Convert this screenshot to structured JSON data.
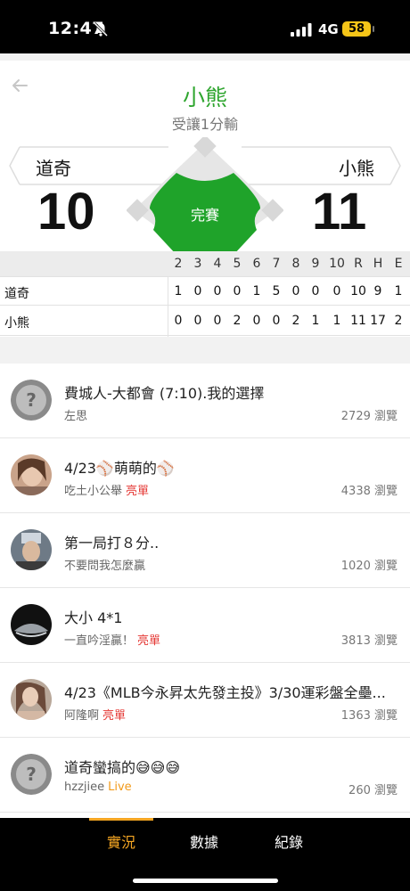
{
  "status_bar": {
    "time": "12:47",
    "network": "4G",
    "battery": "58"
  },
  "header": {
    "title": "小熊",
    "subtitle": "受讓1分輸"
  },
  "game": {
    "away": {
      "name": "道奇",
      "score": "10"
    },
    "home": {
      "name": "小熊",
      "score": "11"
    },
    "status": "完賽"
  },
  "box_score": {
    "columns": [
      "2",
      "3",
      "4",
      "5",
      "6",
      "7",
      "8",
      "9",
      "10",
      "R",
      "H",
      "E"
    ],
    "away": {
      "name": "道奇",
      "values": [
        "1",
        "0",
        "0",
        "0",
        "1",
        "5",
        "0",
        "0",
        "0",
        "10",
        "9",
        "1"
      ]
    },
    "home": {
      "name": "小熊",
      "values": [
        "0",
        "0",
        "0",
        "2",
        "0",
        "0",
        "2",
        "1",
        "1",
        "11",
        "17",
        "2"
      ]
    }
  },
  "posts": [
    {
      "title": "費城人-大都會 (7:10).我的選擇",
      "author": "左思",
      "badge": "",
      "views": "2729 瀏覽",
      "avatar": "placeholder"
    },
    {
      "title": "4/23⚾萌萌的⚾",
      "author": "吃土小公舉",
      "badge": "亮單",
      "views": "4338 瀏覽",
      "avatar": "photo"
    },
    {
      "title": "第一局打８分..",
      "author": "不要問我怎麼贏",
      "badge": "",
      "views": "1020 瀏覽",
      "avatar": "photo"
    },
    {
      "title": "大小 4*1",
      "author": "一直吟淫贏！",
      "badge": "亮單",
      "views": "3813 瀏覽",
      "avatar": "photo"
    },
    {
      "title": "4/23《MLB今永昇太先發主投》3/30運彩盤全壘...",
      "author": "阿隆啊",
      "badge": "亮單",
      "views": "1363 瀏覽",
      "avatar": "photo"
    },
    {
      "title": "道奇蠻搞的😅😅😅",
      "author": "hzzjiee",
      "badge": "Live",
      "views": "260 瀏覽",
      "avatar": "placeholder"
    }
  ],
  "tabs": [
    "實況",
    "數據",
    "紀錄"
  ],
  "colors": {
    "accent_green": "#2ea52e",
    "tab_active": "#f5a623",
    "badge_red": "#e53935",
    "badge_orange": "#f29a1a"
  }
}
